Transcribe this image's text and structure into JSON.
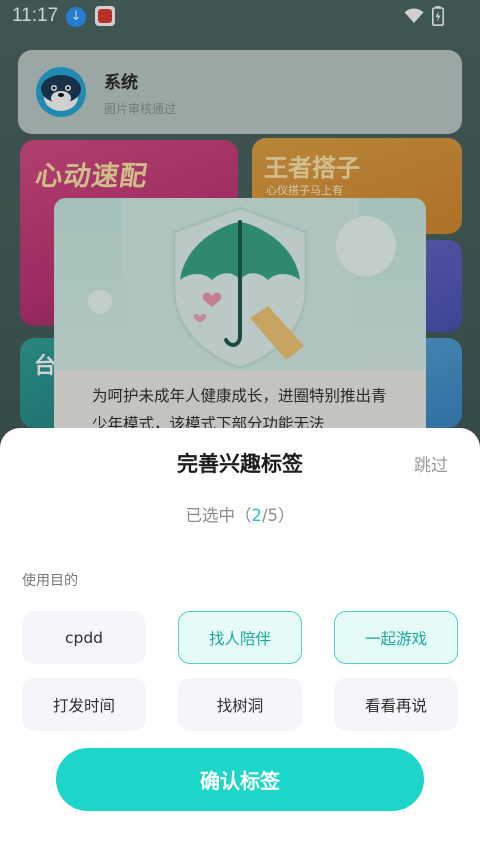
{
  "status_bar": {
    "time": "11:17"
  },
  "background": {
    "system_card": {
      "title": "系统",
      "subtitle": "图片审核通过"
    },
    "banner_1": {
      "title": "心动速配"
    },
    "banner_2": {
      "title": "王者搭子",
      "subtitle": "心仪搭子马上有"
    },
    "banner_4": {
      "title": "台"
    },
    "teen_dialog": {
      "text": "为呵护未成年人健康成长，进圈特别推出青少年模式，该模式下部分功能无法"
    }
  },
  "sheet": {
    "title": "完善兴趣标签",
    "skip_label": "跳过",
    "counter_prefix": "已选中（",
    "counter_selected": "2",
    "counter_suffix": "/5）",
    "section_label": "使用目的",
    "tags": [
      {
        "label": "cpdd",
        "selected": false
      },
      {
        "label": "找人陪伴",
        "selected": true
      },
      {
        "label": "一起游戏",
        "selected": true
      },
      {
        "label": "打发时间",
        "selected": false
      },
      {
        "label": "找树洞",
        "selected": false
      },
      {
        "label": "看看再说",
        "selected": false
      }
    ],
    "confirm_label": "确认标签"
  },
  "colors": {
    "accent": "#1cd7c9",
    "selected_text": "#1aa99f",
    "selected_bg": "#e6fbf8"
  }
}
